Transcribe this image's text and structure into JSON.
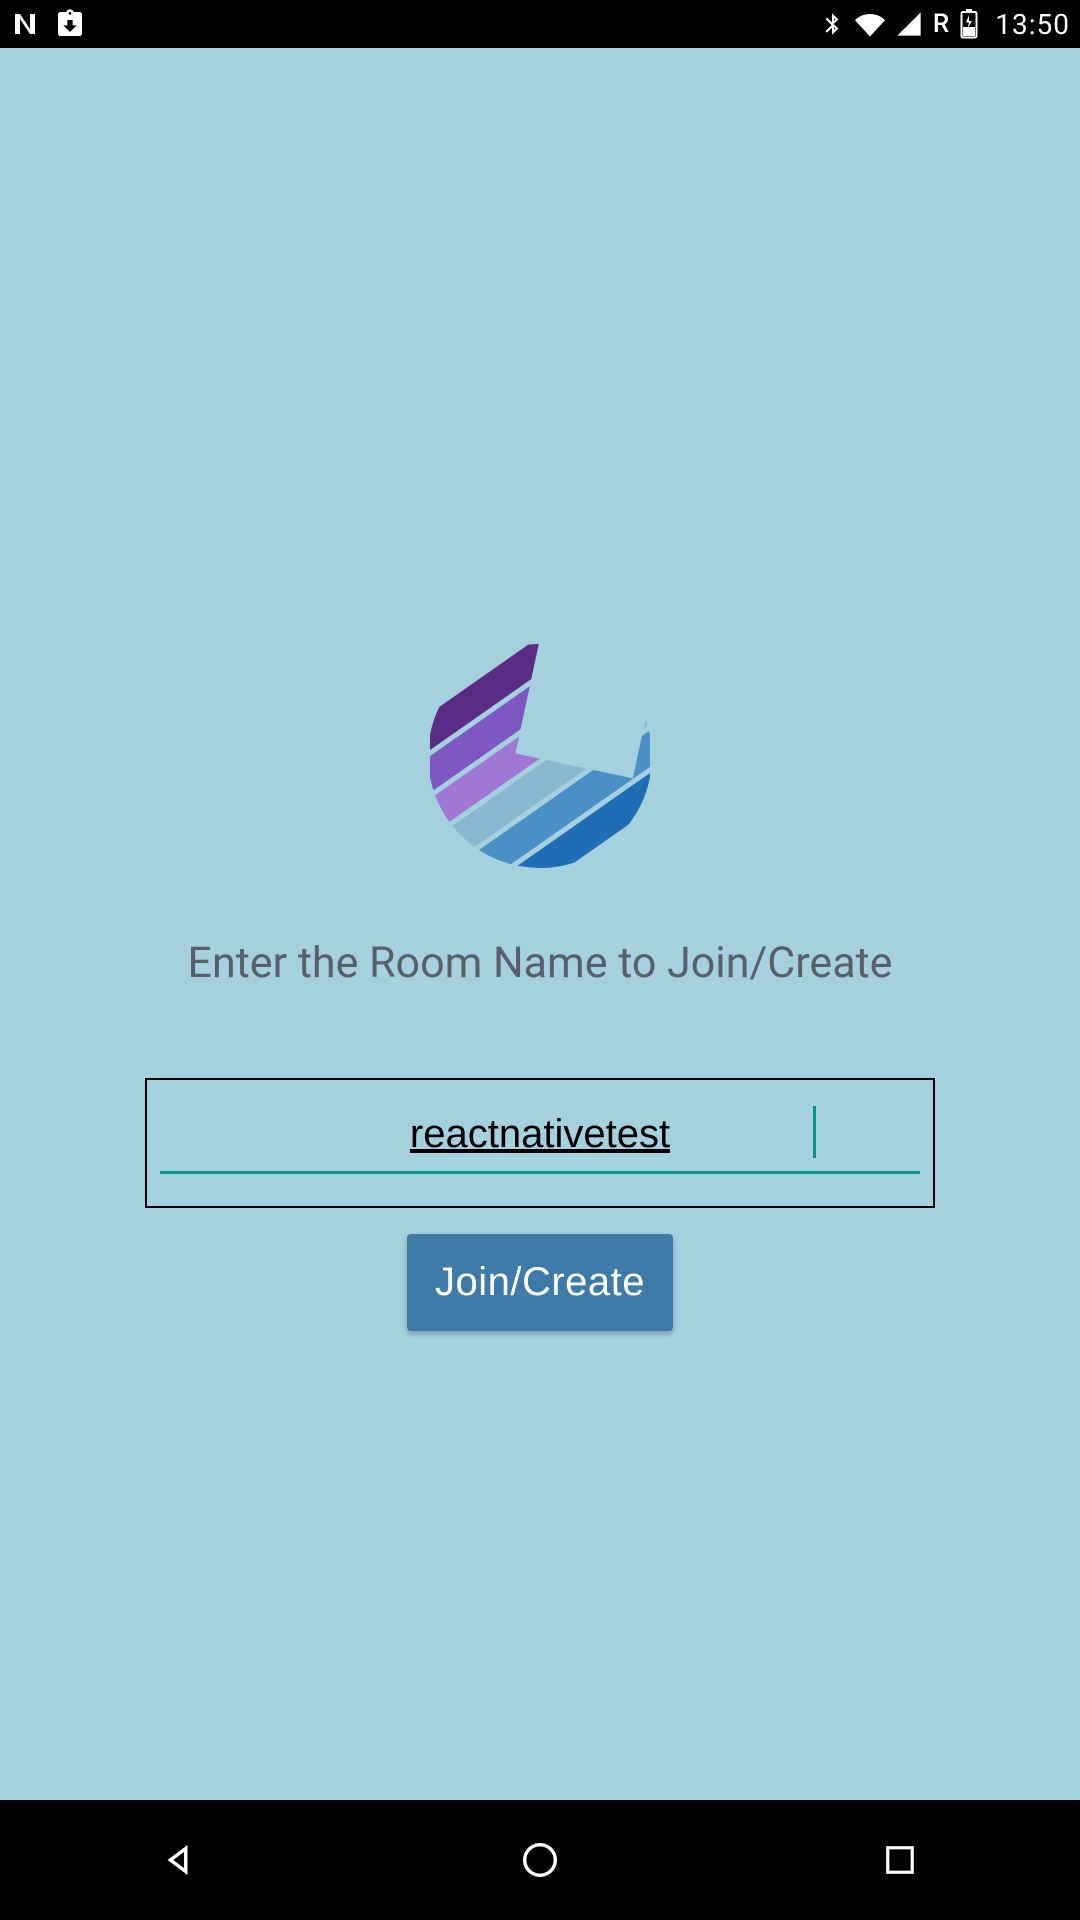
{
  "status_bar": {
    "time": "13:50",
    "roaming_label": "R"
  },
  "main": {
    "prompt": "Enter the Room Name to Join/Create",
    "room_value": "reactnativetest",
    "join_button": "Join/Create"
  },
  "colors": {
    "background": "#A5D0DE",
    "button": "#3F7BA8",
    "accent": "#009688"
  },
  "logo_stripe_colors": [
    "#5B2C86",
    "#7E57C2",
    "#A177D6",
    "#8BB8D1",
    "#4A90C7",
    "#1E6DB5"
  ]
}
